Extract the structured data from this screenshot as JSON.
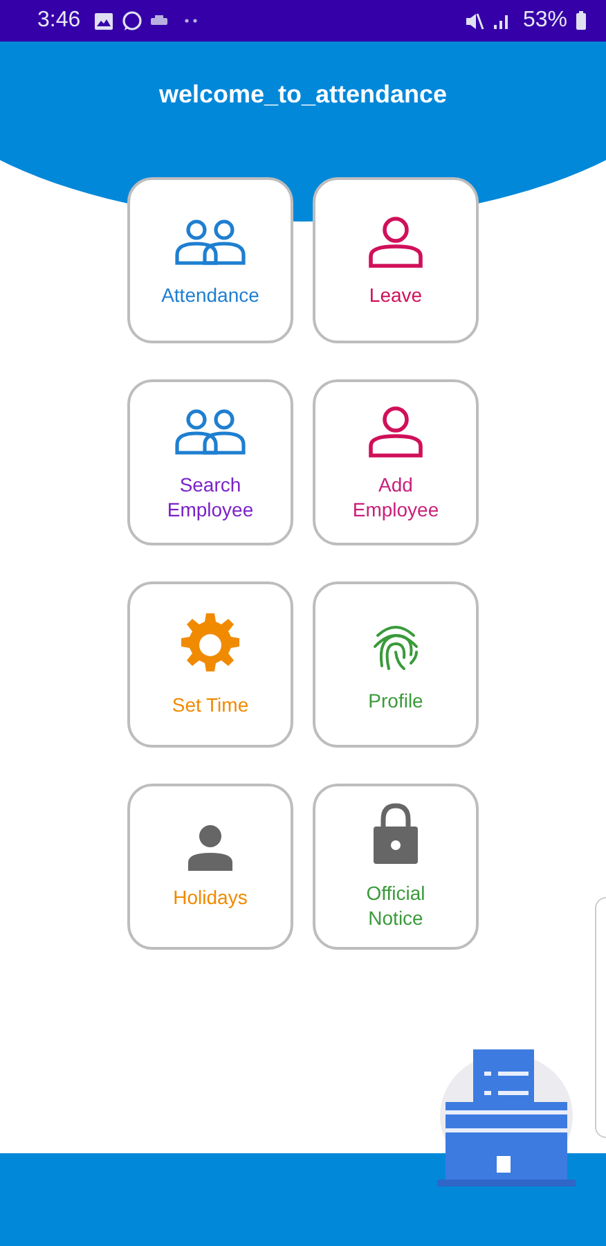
{
  "status_bar": {
    "time": "3:46",
    "battery": "53%"
  },
  "header": {
    "title": "welcome_to_attendance"
  },
  "tiles": [
    {
      "label": "Attendance",
      "kind": "people",
      "color": "#1e7fd0"
    },
    {
      "label": "Leave",
      "kind": "person",
      "color": "#d0105a"
    },
    {
      "label": "Search Employee",
      "kind": "people",
      "color": "#7a22c8"
    },
    {
      "label": "Add Employee",
      "kind": "person",
      "color": "#c8207a"
    },
    {
      "label": "Set Time",
      "kind": "gear",
      "color": "#f08a00"
    },
    {
      "label": "Profile",
      "kind": "fingerprint",
      "color": "#3a9a3a"
    },
    {
      "label": "Holidays",
      "kind": "solid",
      "color": "#f08a00"
    },
    {
      "label": "Official Notice",
      "kind": "lock",
      "color": "#3a9a3a"
    }
  ]
}
